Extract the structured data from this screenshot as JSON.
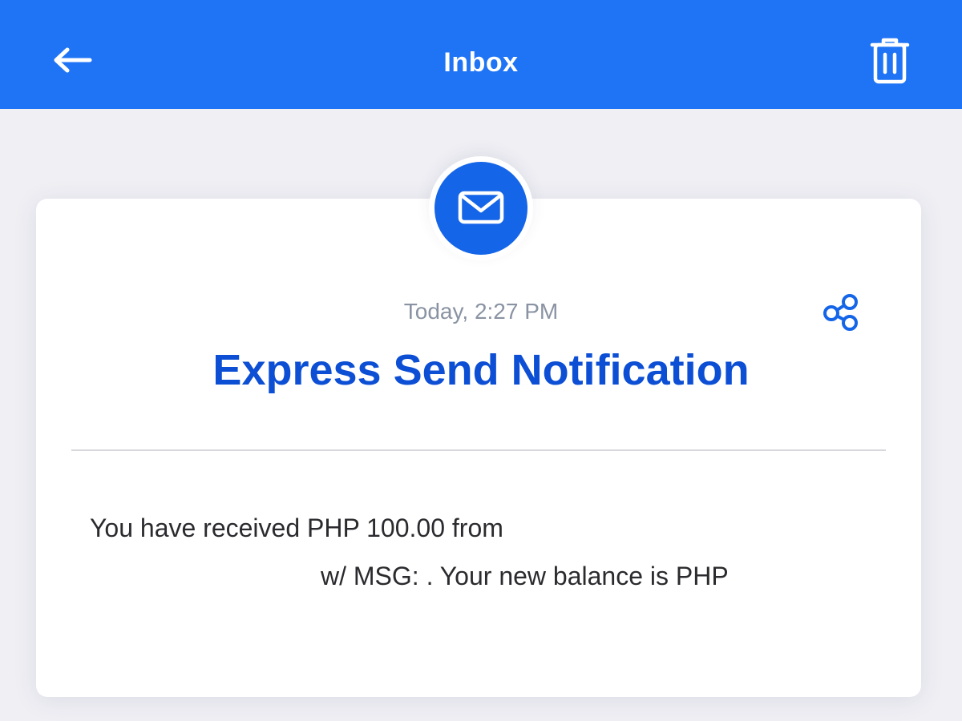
{
  "header": {
    "title": "Inbox",
    "back_icon": "arrow-left-icon",
    "delete_icon": "trash-icon",
    "background_color": "#1f74f6"
  },
  "message": {
    "icon": "envelope-icon",
    "timestamp": "Today, 2:27 PM",
    "title": "Express Send Notification",
    "share_icon": "share-icon",
    "body_line1": "You have received PHP 100.00 from",
    "body_line2": "w/ MSG: . Your new balance is PHP",
    "accent_color": "#0d4fd4"
  }
}
